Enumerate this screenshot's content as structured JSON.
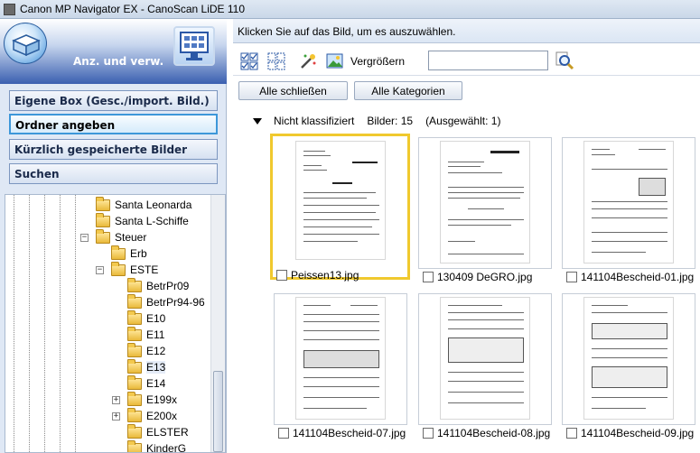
{
  "window": {
    "title": "Canon MP Navigator EX - CanoScan LiDE 110"
  },
  "left_panel": {
    "header_label": "Anz. und verw.",
    "nav_buttons": [
      {
        "label": "Eigene Box (Gesc./import. Bild.)",
        "active": false
      },
      {
        "label": "Ordner angeben",
        "active": true
      },
      {
        "label": "Kürzlich gespeicherte Bilder",
        "active": false
      },
      {
        "label": "Suchen",
        "active": false
      }
    ],
    "tree": [
      {
        "label": "Santa Leonarda",
        "expander": ""
      },
      {
        "label": "Santa L-Schiffe",
        "expander": ""
      },
      {
        "label": "Steuer",
        "expander": "−"
      },
      {
        "label": "Erb",
        "expander": ""
      },
      {
        "label": "ESTE",
        "expander": "−"
      },
      {
        "label": "BetrPr09",
        "expander": ""
      },
      {
        "label": "BetrPr94-96",
        "expander": ""
      },
      {
        "label": "E10",
        "expander": ""
      },
      {
        "label": "E11",
        "expander": ""
      },
      {
        "label": "E12",
        "expander": ""
      },
      {
        "label": "E13",
        "expander": "",
        "selected": true
      },
      {
        "label": "E14",
        "expander": ""
      },
      {
        "label": "E199x",
        "expander": "+"
      },
      {
        "label": "E200x",
        "expander": "+"
      },
      {
        "label": "ELSTER",
        "expander": ""
      },
      {
        "label": "KinderG",
        "expander": ""
      }
    ]
  },
  "right_panel": {
    "hint": "Klicken Sie auf das Bild, um es auszuwählen.",
    "toolbar": {
      "zoom_label": "Vergrößern",
      "search_value": ""
    },
    "buttons": {
      "close_all": "Alle schließen",
      "all_categories": "Alle Kategorien"
    },
    "group": {
      "name": "Nicht klassifiziert",
      "count_text": "Bilder: 15",
      "selected_text": "(Ausgewählt: 1)"
    },
    "thumbnails": [
      {
        "filename": "Peissen13.jpg",
        "selected": true
      },
      {
        "filename": "130409 DeGRO.jpg",
        "selected": false
      },
      {
        "filename": "141104Bescheid-01.jpg",
        "selected": false
      },
      {
        "filename": "141104Bescheid-07.jpg",
        "selected": false
      },
      {
        "filename": "141104Bescheid-08.jpg",
        "selected": false
      },
      {
        "filename": "141104Bescheid-09.jpg",
        "selected": false
      }
    ]
  },
  "colors": {
    "selection_border": "#f0c92e",
    "header_blue": "#3a5fb0",
    "active_nav_border": "#3d97d9"
  }
}
